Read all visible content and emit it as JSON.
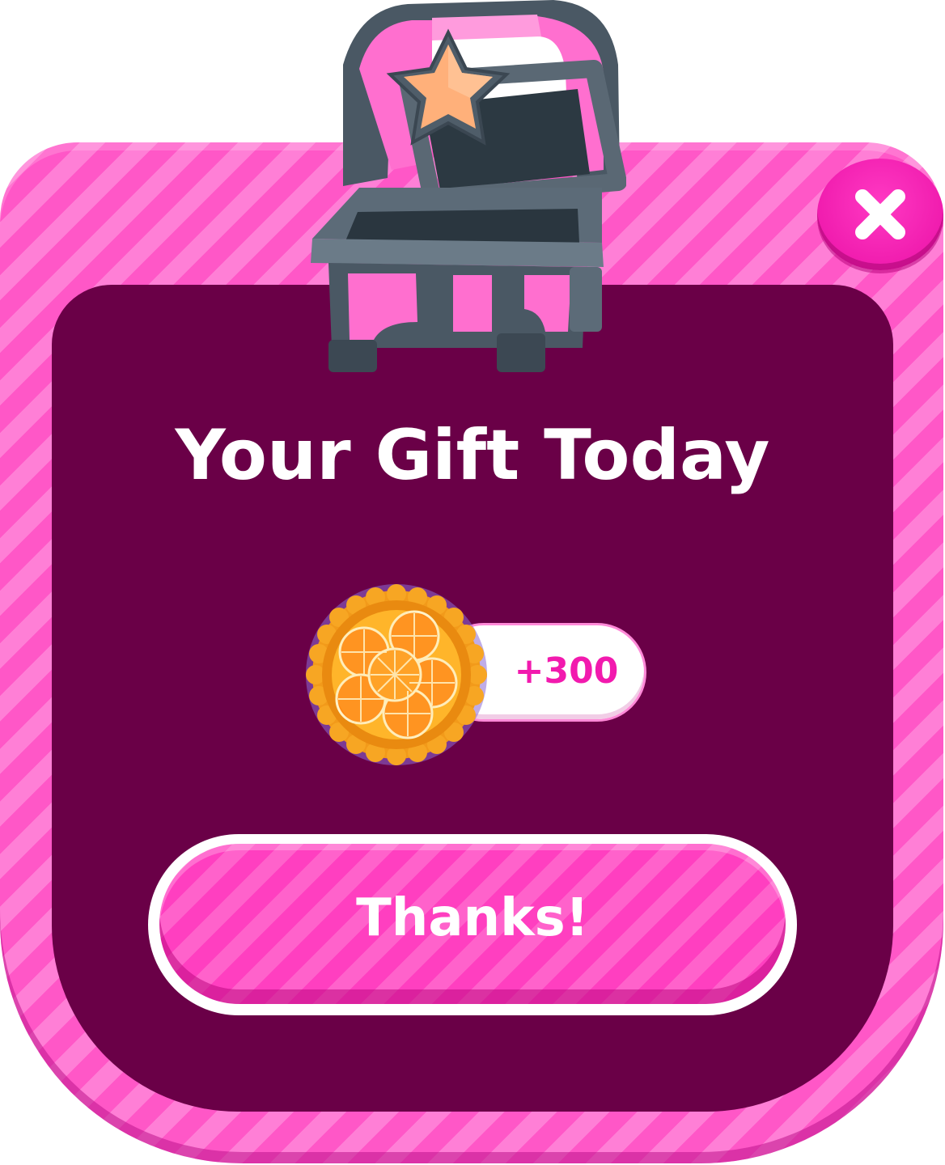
{
  "dialog": {
    "title": "Your Gift Today",
    "close_icon": "close-icon",
    "chest_icon": "treasure-chest-icon"
  },
  "reward": {
    "icon": "orange-pie-icon",
    "amount": "+300"
  },
  "actions": {
    "confirm_label": "Thanks!"
  },
  "colors": {
    "frame_pink": "#ff57c7",
    "panel_plum": "#6a0047",
    "accent_magenta": "#f21aae",
    "text_white": "#ffffff"
  }
}
